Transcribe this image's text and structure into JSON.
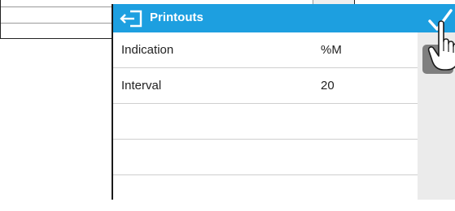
{
  "dialog": {
    "title": "Printouts",
    "rows": [
      {
        "label": "Indication",
        "value": "%M"
      },
      {
        "label": "Interval",
        "value": "20"
      },
      {
        "label": "",
        "value": ""
      },
      {
        "label": "",
        "value": ""
      },
      {
        "label": "",
        "value": ""
      }
    ]
  },
  "icons": {
    "back": "back-exit-icon",
    "confirm": "checkmark-icon",
    "pointer": "hand-pointer-icon"
  },
  "colors": {
    "titlebar": "#1d9fe0",
    "sidebar": "#ebebeb",
    "side_button": "#7f7f7f"
  }
}
